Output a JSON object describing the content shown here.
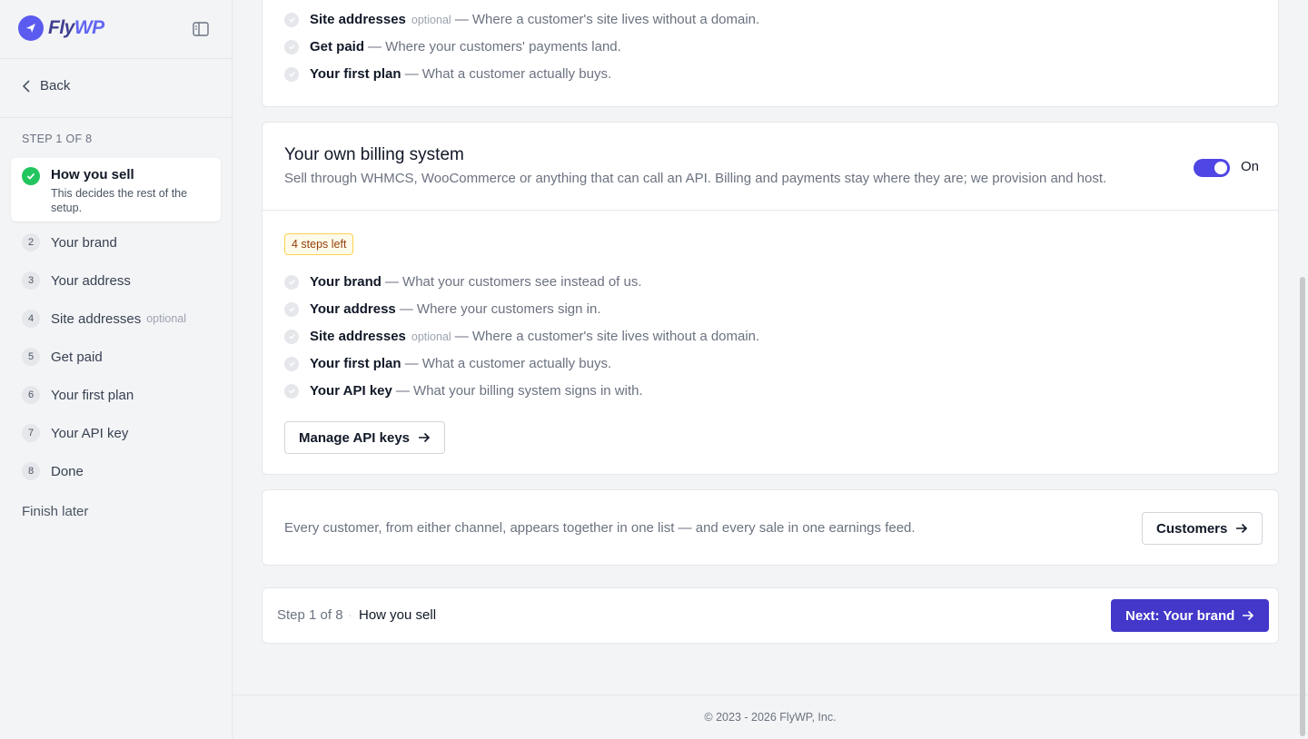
{
  "brand": {
    "name_part1": "Fly",
    "name_part2": "WP"
  },
  "sidebar": {
    "back_label": "Back",
    "step_count": "STEP 1 OF 8",
    "active_step": {
      "title": "How you sell",
      "desc": "This decides the rest of the setup."
    },
    "steps": [
      {
        "num": "2",
        "label": "Your brand",
        "opt": ""
      },
      {
        "num": "3",
        "label": "Your address",
        "opt": ""
      },
      {
        "num": "4",
        "label": "Site addresses",
        "opt": "optional"
      },
      {
        "num": "5",
        "label": "Get paid",
        "opt": ""
      },
      {
        "num": "6",
        "label": "Your first plan",
        "opt": ""
      },
      {
        "num": "7",
        "label": "Your API key",
        "opt": ""
      },
      {
        "num": "8",
        "label": "Done",
        "opt": ""
      }
    ],
    "finish_later": "Finish later"
  },
  "top_card": {
    "items": [
      {
        "name": "Site addresses",
        "opt": "optional",
        "desc": "— Where a customer's site lives without a domain."
      },
      {
        "name": "Get paid",
        "opt": "",
        "desc": "— Where your customers' payments land."
      },
      {
        "name": "Your first plan",
        "opt": "",
        "desc": "— What a customer actually buys."
      }
    ]
  },
  "billing_card": {
    "title": "Your own billing system",
    "desc": "Sell through WHMCS, WooCommerce or anything that can call an API. Billing and payments stay where they are; we provision and host.",
    "toggle_label": "On",
    "badge": "4 steps left",
    "items": [
      {
        "name": "Your brand",
        "opt": "",
        "desc": "— What your customers see instead of us."
      },
      {
        "name": "Your address",
        "opt": "",
        "desc": "— Where your customers sign in."
      },
      {
        "name": "Site addresses",
        "opt": "optional",
        "desc": "— Where a customer's site lives without a domain."
      },
      {
        "name": "Your first plan",
        "opt": "",
        "desc": "— What a customer actually buys."
      },
      {
        "name": "Your API key",
        "opt": "",
        "desc": "— What your billing system signs in with."
      }
    ],
    "button": "Manage API keys"
  },
  "info_card": {
    "text": "Every customer, from either channel, appears together in one list — and every sale in one earnings feed.",
    "button": "Customers"
  },
  "step_bar": {
    "counter": "Step 1 of 8",
    "separator": "·",
    "current": "How you sell",
    "next_button": "Next: Your brand"
  },
  "footer": {
    "copyright": "© 2023 - 2026 FlyWP, Inc."
  },
  "colors": {
    "accent": "#4338ca",
    "toggle": "#4f46e5",
    "success": "#22c55e",
    "badge_border": "#fcd34d"
  }
}
